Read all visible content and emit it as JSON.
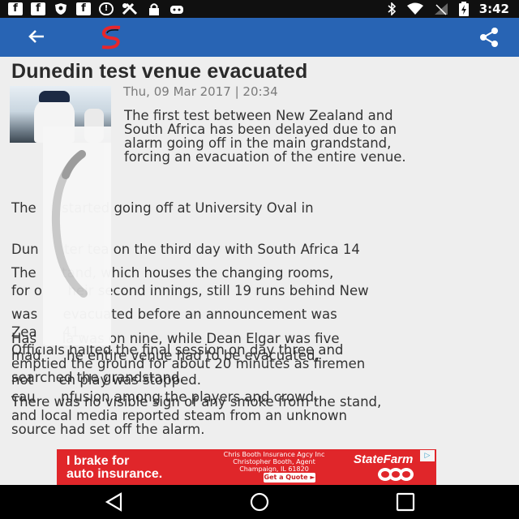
{
  "status_bar": {
    "time": "3:42",
    "left_icons": [
      "facebook-icon",
      "facebook-icon",
      "shield-icon",
      "facebook-icon",
      "blocked-icon",
      "tools-icon",
      "lock-icon",
      "android-icon"
    ],
    "right_icons": [
      "bluetooth-icon",
      "wifi-icon",
      "signal-icon",
      "battery-icon"
    ]
  },
  "app_bar": {
    "color": "#2864b4",
    "back_icon": "arrow-back-icon",
    "logo": "supersport-logo",
    "share_icon": "share-icon"
  },
  "article": {
    "title": "Dunedin test venue evacuated",
    "date": "Thu, 09 Mar 2017 | 20:34",
    "paragraphs": [
      [
        "The first test between New Zealand and",
        "South Africa has been delayed due to an",
        "alarm going off in the main grandstand,",
        "forcing an evacuation of the entire venue."
      ],
      [
        "The      started going off at University Oval in",
        "Dun      ter tea on the third day with South Africa 14",
        "for o      heir second innings, still 19 runs behind New",
        "Zea      41."
      ],
      [
        "The      tand, which houses the changing rooms,",
        "was      evacuated before an announcement was",
        "mad      he entire venue had to be evacuated,",
        "cau      nfusion among the players and crowd."
      ],
      [
        "Has      la was on nine, while Dean Elgar was five",
        "not      en play was stopped."
      ],
      [
        "Officials halted the final session on day three and",
        "emptied the ground for about 20 minutes as firemen",
        "searched the grandstand."
      ],
      [
        "There was no visible sign of any smoke from the stand,",
        "and local media reported steam from an unknown",
        "source had set off the alarm."
      ]
    ]
  },
  "ad": {
    "line1": "I brake for",
    "line2": "auto insurance.",
    "agency": "Chris Booth Insurance Agcy Inc",
    "agent": "Christopher Booth, Agent",
    "address": "Champaign, IL 61820",
    "cta": "Get a Quote ►",
    "brand": "StateFarm",
    "background": "#e0262a"
  },
  "nav_bar": {
    "back": "nav-back-icon",
    "home": "nav-home-icon",
    "recents": "nav-recents-icon"
  }
}
